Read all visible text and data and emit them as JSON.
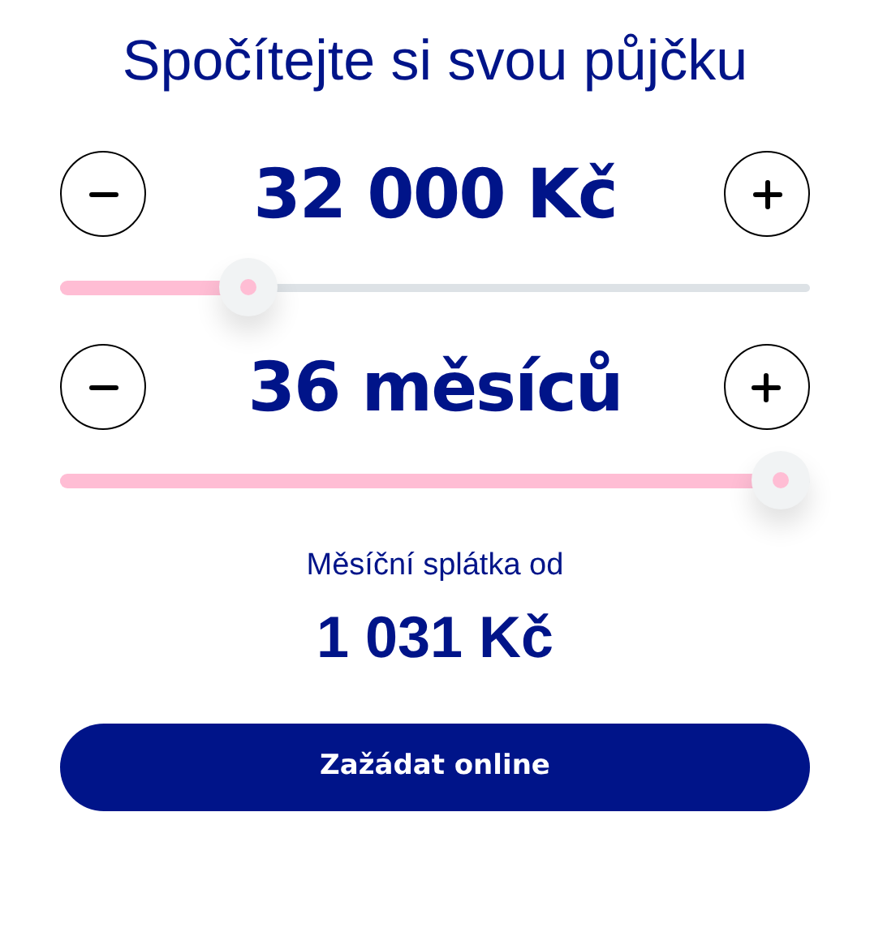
{
  "title": "Spočítejte si svou půjčku",
  "steppers": [
    {
      "value": "32 000 Kč",
      "level": 0.23
    },
    {
      "value": "36 měsíců",
      "level": 1
    }
  ],
  "result": {
    "label": "Měsíční splátka od",
    "amount": "1 031 Kč"
  },
  "button": {
    "label": "Zažádat online"
  }
}
